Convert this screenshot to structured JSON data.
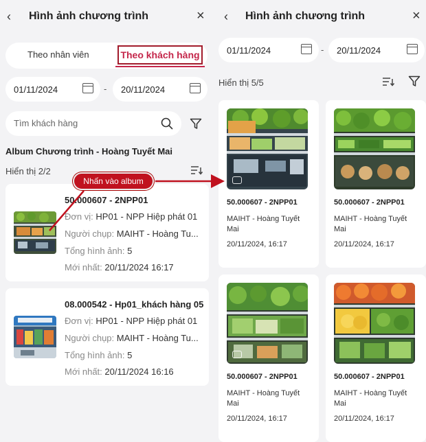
{
  "left": {
    "header": {
      "title": "Hình ảnh chương trình"
    },
    "tabs": [
      {
        "label": "Theo nhân viên",
        "active": false
      },
      {
        "label": "Theo khách hàng",
        "active": true
      }
    ],
    "date_from": "01/11/2024",
    "date_to": "20/11/2024",
    "search": {
      "placeholder": "Tìm khách hàng"
    },
    "section_title": "Album Chương trình - Hoàng Tuyết Mai",
    "count_label": "Hiển thị 2/2",
    "albums": [
      {
        "code": "50.000607 - 2NPP01",
        "unit_label": "Đơn vị:",
        "unit": "HP01 - NPP Hiệp phát 01",
        "shooter_label": "Người chụp:",
        "shooter": "MAIHT - Hoàng Tu...",
        "total_label": "Tổng hình ảnh:",
        "total": "5",
        "latest_label": "Mới nhất:",
        "latest": "20/11/2024 16:17"
      },
      {
        "code": "08.000542 - Hp01_khách hàng 05",
        "unit_label": "Đơn vị:",
        "unit": "HP01 - NPP Hiệp phát 01",
        "shooter_label": "Người chụp:",
        "shooter": "MAIHT - Hoàng Tu...",
        "total_label": "Tổng hình ảnh:",
        "total": "5",
        "latest_label": "Mới nhất:",
        "latest": "20/11/2024 16:16"
      }
    ]
  },
  "right": {
    "header": {
      "title": "Hình ảnh chương trình"
    },
    "date_from": "01/11/2024",
    "date_to": "20/11/2024",
    "count_label": "Hiển thị 5/5",
    "photos": [
      {
        "code": "50.000607 - 2NPP01",
        "who": "MAIHT - Hoàng Tuyết Mai",
        "when": "20/11/2024, 16:17"
      },
      {
        "code": "50.000607 - 2NPP01",
        "who": "MAIHT - Hoàng Tuyết Mai",
        "when": "20/11/2024, 16:17"
      },
      {
        "code": "50.000607 - 2NPP01",
        "who": "MAIHT - Hoàng Tuyết Mai",
        "when": "20/11/2024, 16:17"
      },
      {
        "code": "50.000607 - 2NPP01",
        "who": "MAIHT - Hoàng Tuyết Mai",
        "when": "20/11/2024, 16:17"
      }
    ]
  },
  "annotation": {
    "label": "Nhấn vào album"
  },
  "icons": {
    "back": "chevron-left-icon",
    "close": "close-icon",
    "calendar": "calendar-icon",
    "search": "search-icon",
    "filter": "filter-icon",
    "sort": "sort-icon",
    "camera": "camera-icon"
  },
  "colors": {
    "accent": "#c4264a",
    "annotation": "#c0121f",
    "page_bg": "#f3f3f5",
    "card_bg": "#ffffff"
  }
}
